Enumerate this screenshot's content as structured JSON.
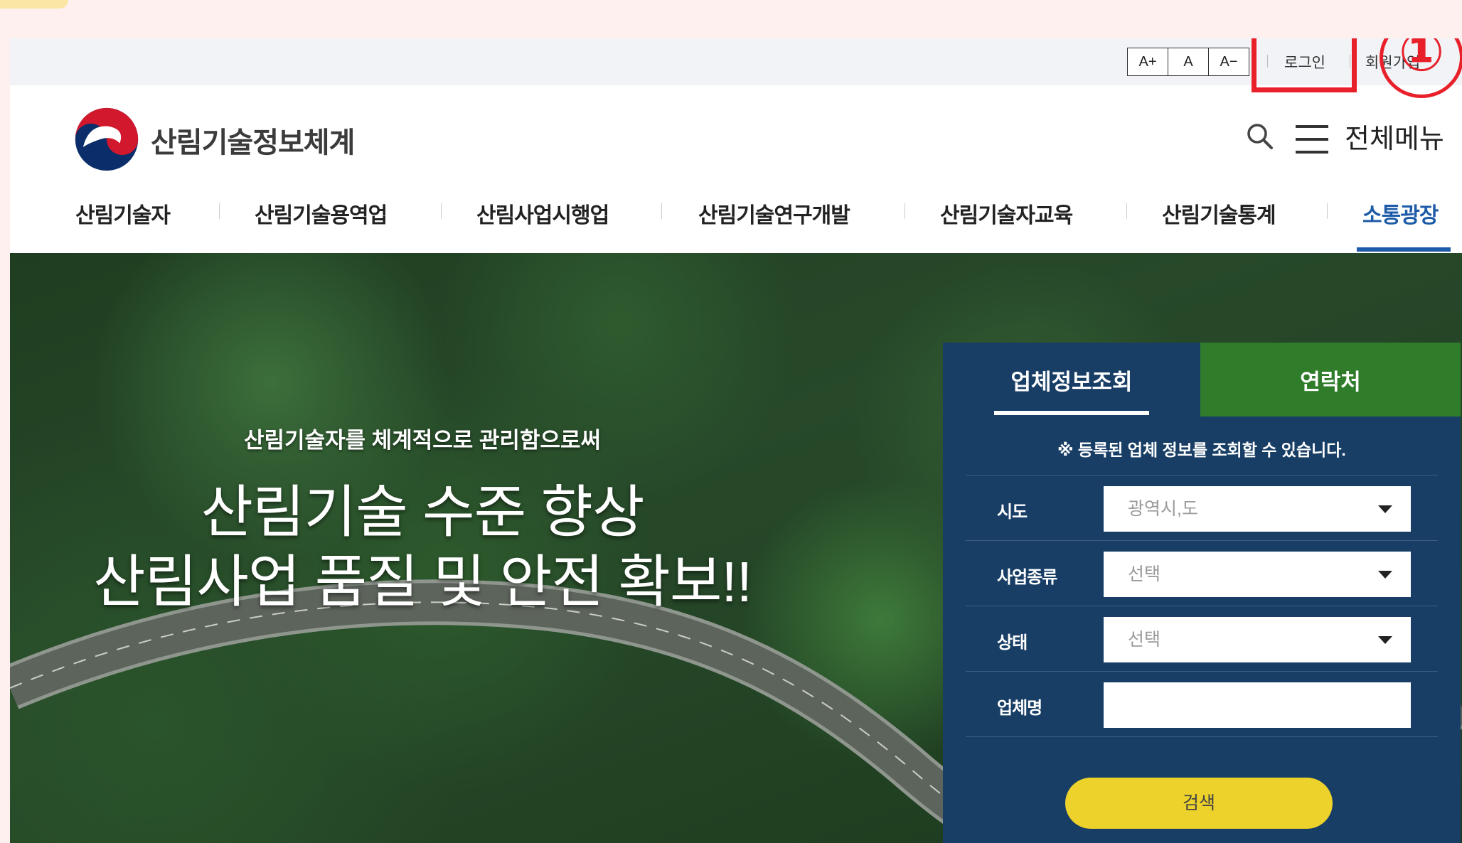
{
  "util": {
    "font_large": "A+",
    "font_normal": "A",
    "font_small": "A−",
    "login": "로그인",
    "join": "회원가입",
    "highlight_number": "①"
  },
  "header": {
    "title": "산림기술정보체계",
    "all_menu": "전체메뉴"
  },
  "gnb": {
    "items": [
      {
        "label": "산림기술자",
        "active": false
      },
      {
        "label": "산림기술용역업",
        "active": false
      },
      {
        "label": "산림사업시행업",
        "active": false
      },
      {
        "label": "산림기술연구개발",
        "active": false
      },
      {
        "label": "산림기술자교육",
        "active": false
      },
      {
        "label": "산림기술통계",
        "active": false
      },
      {
        "label": "소통광장",
        "active": true
      }
    ]
  },
  "hero": {
    "subtitle": "산림기술자를 체계적으로 관리함으로써",
    "title_line1": "산림기술 수준 향상",
    "title_line2": "산림사업 품질 및 안전 확보!!"
  },
  "panel": {
    "tabs": [
      {
        "label": "업체정보조회",
        "active": true
      },
      {
        "label": "연락처",
        "active": false
      }
    ],
    "notice": "※ 등록된 업체 정보를 조회할 수 있습니다.",
    "fields": [
      {
        "label": "시도",
        "value": "광역시,도"
      },
      {
        "label": "사업종류",
        "value": "선택"
      },
      {
        "label": "상태",
        "value": "선택"
      },
      {
        "label": "업체명",
        "value": ""
      }
    ],
    "search_button": "검색"
  },
  "colors": {
    "accent": "#1d5aa8",
    "panel_navy": "#183e66",
    "tab_green": "#2f7d2a",
    "button_yellow": "#ecd22a",
    "highlight_red": "#e8202a"
  }
}
